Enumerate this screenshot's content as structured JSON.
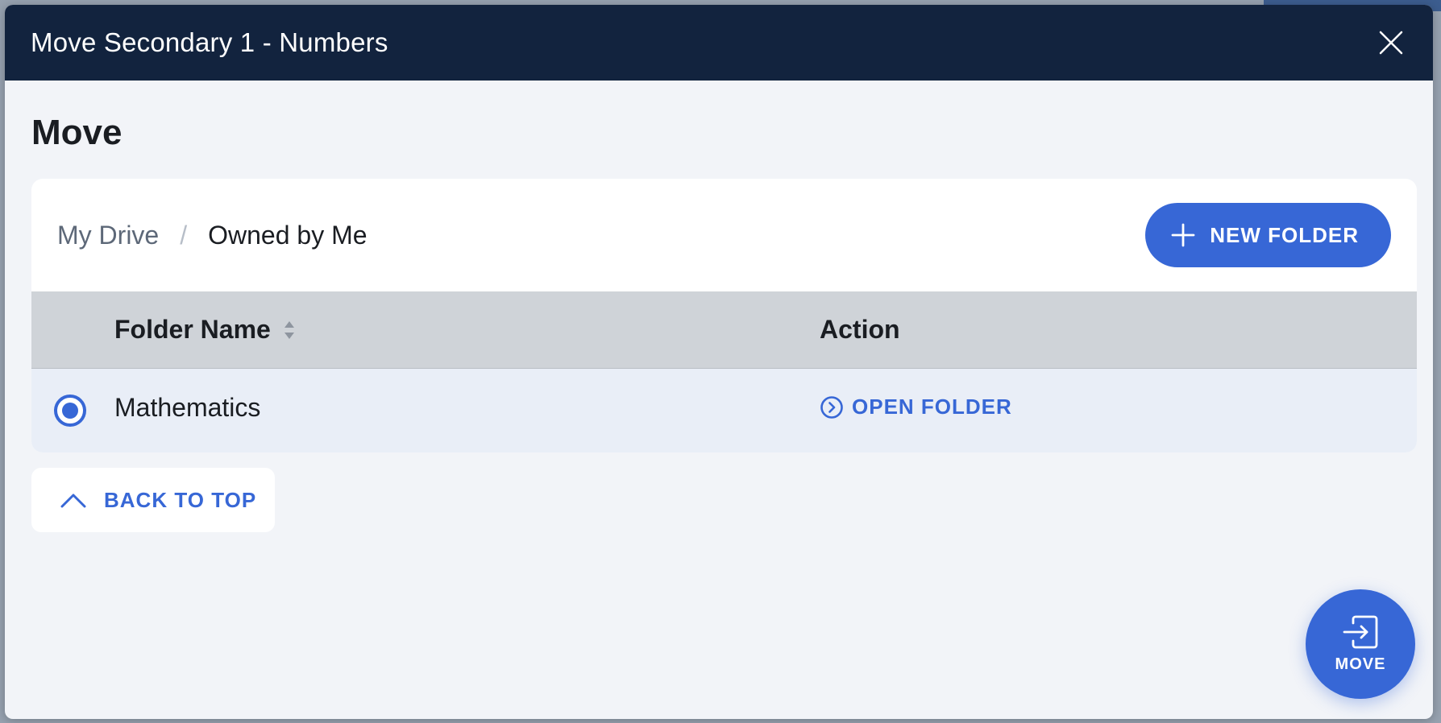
{
  "modal": {
    "title": "Move Secondary 1 - Numbers",
    "close_icon": "close-icon"
  },
  "section": {
    "heading": "Move"
  },
  "breadcrumb": {
    "root": "My Drive",
    "separator": "/",
    "current": "Owned by Me"
  },
  "toolbar": {
    "new_folder_label": "NEW FOLDER",
    "new_folder_icon": "plus-icon"
  },
  "table": {
    "columns": [
      "Folder Name",
      "Action"
    ],
    "rows": [
      {
        "name": "Mathematics",
        "selected": true,
        "action_label": "OPEN FOLDER",
        "action_icon": "chevron-right-circle-icon"
      }
    ]
  },
  "back_to_top": {
    "label": "BACK TO TOP",
    "icon": "chevron-up-icon"
  },
  "move_button": {
    "label": "MOVE",
    "icon": "move-into-icon"
  },
  "colors": {
    "header_bg": "#12233e",
    "accent": "#3767d6",
    "page_bg": "#f2f4f8",
    "table_head_bg": "#cfd3d8",
    "selected_row_bg": "#e9eef7"
  }
}
